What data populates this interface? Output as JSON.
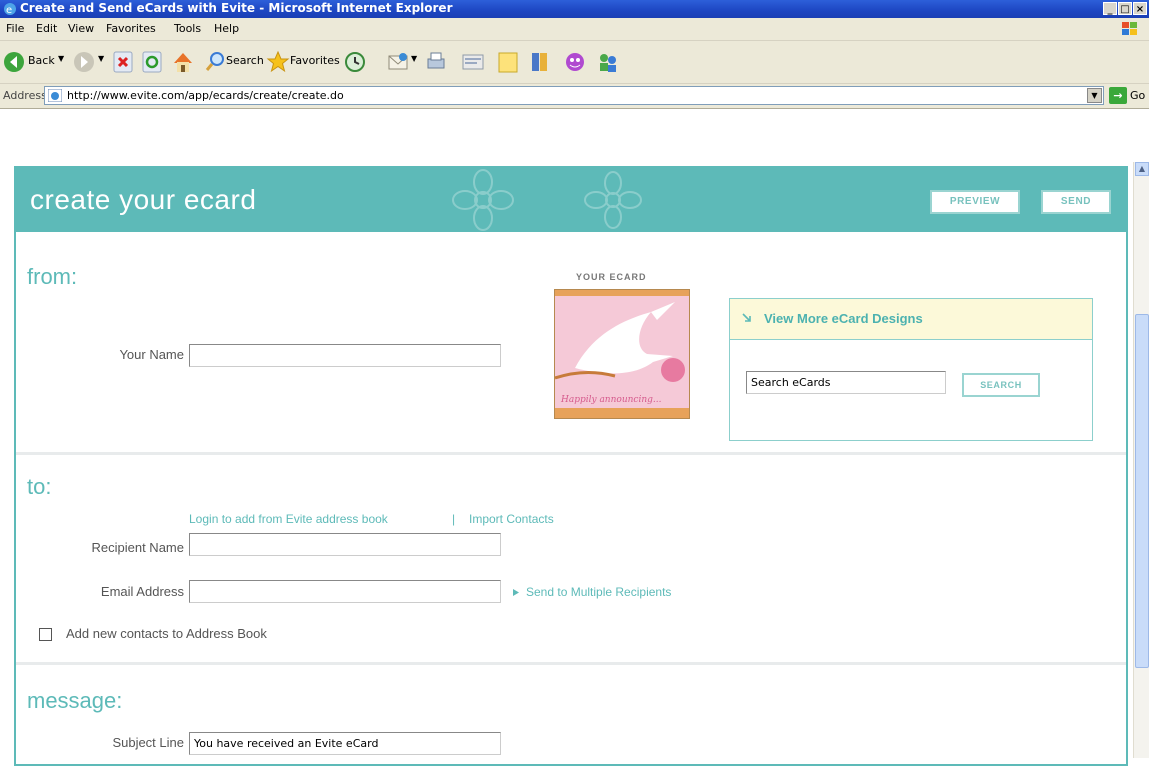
{
  "window": {
    "title": "Create and Send eCards with Evite - Microsoft Internet Explorer",
    "controls": [
      "_",
      "□",
      "×"
    ]
  },
  "menu": [
    "File",
    "Edit",
    "View",
    "Favorites",
    "Tools",
    "Help"
  ],
  "toolbar": {
    "back_label": "Back",
    "search_label": "Search",
    "favorites_label": "Favorites"
  },
  "address": {
    "label": "Address",
    "url": "http://www.evite.com/app/ecards/create/create.do",
    "go_label": "Go"
  },
  "page": {
    "header_title": "create your ecard",
    "preview_label": "PREVIEW",
    "send_label": "SEND",
    "from": {
      "title": "from:",
      "your_name_label": "Your Name",
      "your_name_value": ""
    },
    "ecard": {
      "label": "YOUR ECARD",
      "thumb_text": "Happily announcing..."
    },
    "more_designs": {
      "title": "View More eCard Designs",
      "search_placeholder": "Search eCards",
      "search_button": "SEARCH"
    },
    "to": {
      "title": "to:",
      "login_link": "Login to add from Evite address book",
      "separator": " | ",
      "import_link": "Import Contacts",
      "recipient_label": "Recipient Name",
      "recipient_value": "",
      "email_label": "Email Address",
      "email_value": "",
      "multiple_link": "Send to Multiple Recipients",
      "add_contacts_label": "Add new contacts to Address Book",
      "add_contacts_checked": false
    },
    "message": {
      "title": "message:",
      "subject_label": "Subject Line",
      "subject_value": "You have received an Evite eCard"
    }
  },
  "colors": {
    "brand_teal": "#5dbab8",
    "button_border": "#9ad4d1",
    "more_header_bg": "#fcf9d9",
    "card_pink": "#f3c6d6"
  }
}
